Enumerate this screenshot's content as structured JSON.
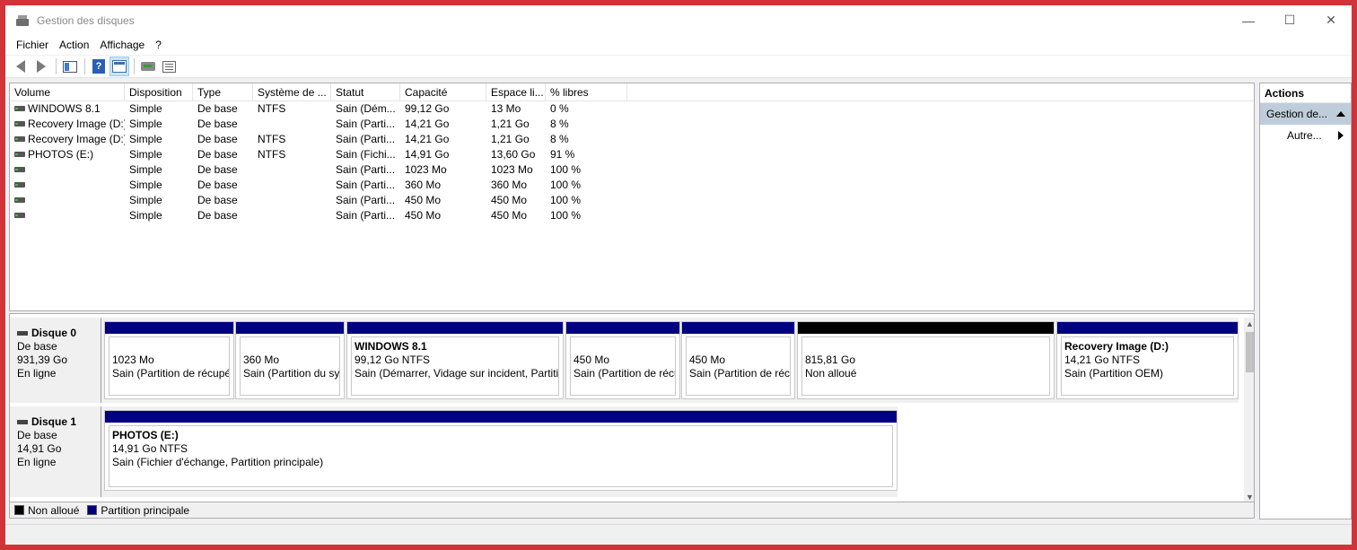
{
  "window": {
    "title": "Gestion des disques",
    "minimize": "—",
    "maximize": "☐",
    "close": "✕"
  },
  "menu": [
    "Fichier",
    "Action",
    "Affichage",
    "?"
  ],
  "volume_table": {
    "columns": [
      "Volume",
      "Disposition",
      "Type",
      "Système de ...",
      "Statut",
      "Capacité",
      "Espace li...",
      "% libres"
    ],
    "rows": [
      [
        "WINDOWS 8.1",
        "Simple",
        "De base",
        "NTFS",
        "Sain (Dém...",
        "99,12 Go",
        "13 Mo",
        "0 %"
      ],
      [
        "Recovery Image (D:)",
        "Simple",
        "De base",
        "",
        "Sain (Parti...",
        "14,21 Go",
        "1,21 Go",
        "8 %"
      ],
      [
        "Recovery Image (D:)",
        "Simple",
        "De base",
        "NTFS",
        "Sain (Parti...",
        "14,21 Go",
        "1,21 Go",
        "8 %"
      ],
      [
        "PHOTOS (E:)",
        "Simple",
        "De base",
        "NTFS",
        "Sain (Fichi...",
        "14,91 Go",
        "13,60 Go",
        "91 %"
      ],
      [
        "",
        "Simple",
        "De base",
        "",
        "Sain (Parti...",
        "1023 Mo",
        "1023 Mo",
        "100 %"
      ],
      [
        "",
        "Simple",
        "De base",
        "",
        "Sain (Parti...",
        "360 Mo",
        "360 Mo",
        "100 %"
      ],
      [
        "",
        "Simple",
        "De base",
        "",
        "Sain (Parti...",
        "450 Mo",
        "450 Mo",
        "100 %"
      ],
      [
        "",
        "Simple",
        "De base",
        "",
        "Sain (Parti...",
        "450 Mo",
        "450 Mo",
        "100 %"
      ]
    ]
  },
  "actions": {
    "title": "Actions",
    "group": "Gestion de...",
    "item": "Autre..."
  },
  "disks": [
    {
      "name": "Disque 0",
      "type": "De base",
      "size": "931,39 Go",
      "status": "En ligne",
      "partitions": [
        {
          "name": "",
          "size": "1023 Mo",
          "status": "Sain (Partition de récupé",
          "bar": "#000080"
        },
        {
          "name": "",
          "size": "360 Mo",
          "status": "Sain (Partition du sys",
          "bar": "#000080"
        },
        {
          "name": "WINDOWS 8.1",
          "size": "99,12 Go NTFS",
          "status": "Sain (Démarrer, Vidage sur incident, Partitic",
          "bar": "#000080"
        },
        {
          "name": "",
          "size": "450 Mo",
          "status": "Sain (Partition de récu",
          "bar": "#000080"
        },
        {
          "name": "",
          "size": "450 Mo",
          "status": "Sain (Partition de récu",
          "bar": "#000080"
        },
        {
          "name": "",
          "size": "815,81 Go",
          "status": "Non alloué",
          "bar": "#000000"
        },
        {
          "name": "Recovery Image  (D:)",
          "size": "14,21 Go NTFS",
          "status": "Sain (Partition OEM)",
          "bar": "#000080"
        }
      ]
    },
    {
      "name": "Disque 1",
      "type": "De base",
      "size": "14,91 Go",
      "status": "En ligne",
      "partitions": [
        {
          "name": "PHOTOS  (E:)",
          "size": "14,91 Go NTFS",
          "status": "Sain (Fichier d'échange, Partition principale)",
          "bar": "#000080"
        }
      ]
    }
  ],
  "legend": [
    {
      "label": "Non alloué",
      "color": "#000000"
    },
    {
      "label": "Partition principale",
      "color": "#000080"
    }
  ],
  "icons": [
    "back-arrow-icon",
    "forward-arrow-icon",
    "console-tree-icon",
    "help-icon",
    "view-icon",
    "rescan-disk-icon",
    "properties-icon"
  ]
}
